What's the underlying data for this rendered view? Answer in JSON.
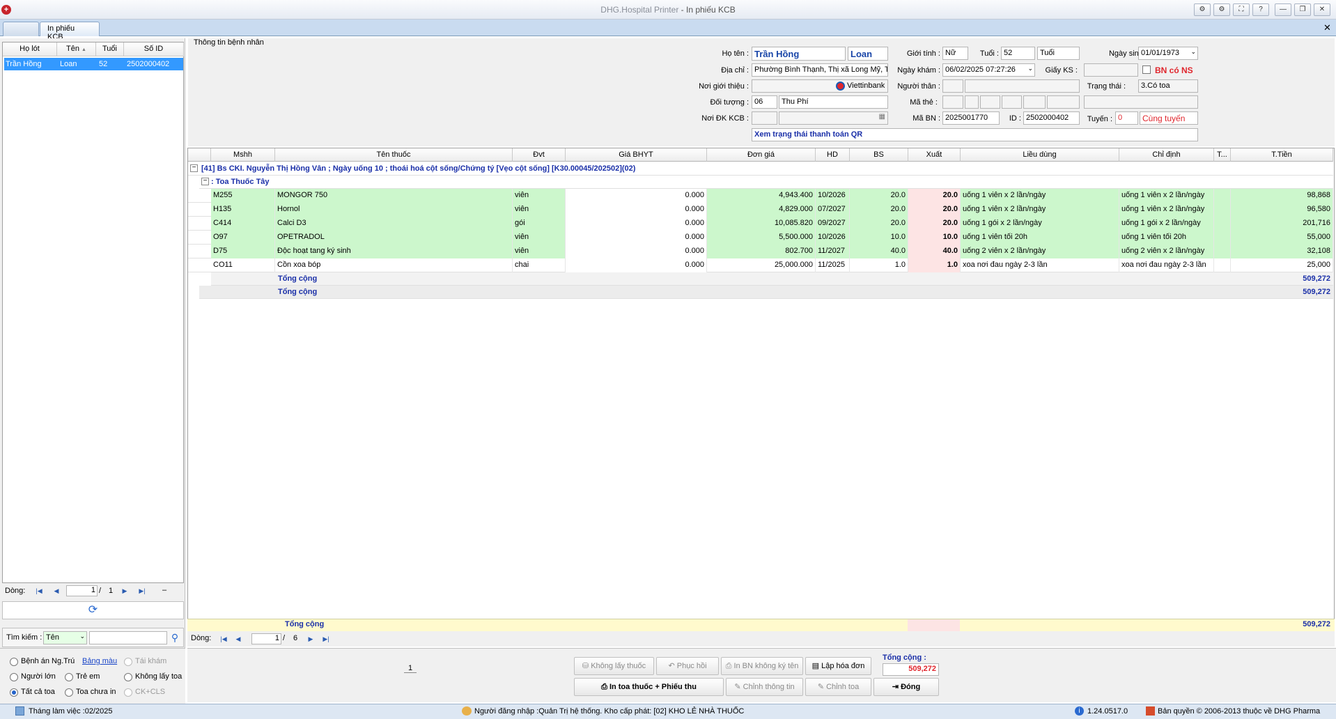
{
  "window": {
    "title_app": "DHG.Hospital Printer",
    "title_sep": " - ",
    "title_form": "In phiếu KCB",
    "controls": [
      "⚙",
      "⚙",
      "⛶",
      "?",
      "—",
      "❐",
      "✕"
    ]
  },
  "tabs": {
    "active": "In phiếu KCB",
    "close": "✕"
  },
  "patient_list": {
    "headers": [
      "Họ lót",
      "Tên",
      "Tuổi",
      "Số ID"
    ],
    "rows": [
      {
        "ho_lot": "Trần Hồng",
        "ten": "Loan",
        "tuoi": "52",
        "so_id": "2502000402"
      }
    ],
    "pager": {
      "label": "Dòng:",
      "page": "1",
      "sep": "/",
      "total": "1",
      "dash": "–"
    }
  },
  "search": {
    "label": "Tìm kiếm :",
    "field": "Tên"
  },
  "filters": {
    "benh_an": "Bệnh án Ng.Trú",
    "bang_mau": "Bảng màu",
    "tai_kham": "Tái khám",
    "nguoi_lon": "Người lớn",
    "tre_em": "Trẻ em",
    "khong_lay_toa": "Không lấy toa",
    "tat_ca_toa": "Tất cả toa",
    "toa_chua_in": "Toa chưa in",
    "ck_cls": "CK+CLS"
  },
  "form": {
    "section_title": "Thông tin bệnh nhân",
    "labels": {
      "ho_ten": "Họ tên :",
      "gioi_tinh": "Giới tính :",
      "tuoi": "Tuổi :",
      "ngay_sinh": "Ngày sinh :",
      "dia_chi": "Địa chỉ :",
      "ngay_kham": "Ngày khám :",
      "giay_ks": "Giấy KS :",
      "bn_co_ns": "BN có NS",
      "noi_gioi_thieu": "Nơi giới thiệu :",
      "nguoi_than": "Người thân :",
      "trang_thai": "Trạng thái :",
      "doi_tuong": "Đối tượng :",
      "ma_the": "Mã thẻ :",
      "noi_dk_kcb": "Nơi ĐK KCB :",
      "ma_bn": "Mã BN :",
      "id": "ID :",
      "tuyen": "Tuyến :"
    },
    "values": {
      "ho_lot": "Trần Hồng",
      "ten": "Loan",
      "gioi_tinh": "Nữ",
      "tuoi": "52",
      "tuoi_unit": "Tuổi",
      "ngay_sinh": "01/01/1973",
      "dia_chi": "Phường Bình Thạnh, Thị xã Long Mỹ, Tỉn",
      "ngay_kham": "06/02/2025 07:27:26",
      "bank": "Viettinbank",
      "trang_thai": "3.Có toa",
      "doi_tuong_code": "06",
      "doi_tuong": "Thu Phí",
      "ma_bn": "2025001770",
      "id": "2502000402",
      "tuyen_code": "0",
      "tuyen": "Cùng tuyến",
      "qr": "Xem trạng thái thanh toán QR"
    }
  },
  "grid": {
    "headers": [
      "Mshh",
      "Tên thuốc",
      "Đvt",
      "Giá BHYT",
      "Đơn giá",
      "HD",
      "BS",
      "Xuất",
      "Liều dùng",
      "Chỉ định",
      "T...",
      "T.Tiền"
    ],
    "group_row": "[41] Bs CKI. Nguyễn Thị Hồng Vân ; Ngày uống 10 ; thoái hoá cột sống/Chứng tý [Vẹo cột sống] [K30.00045/202502](02)",
    "sub_group": ": Toa Thuốc Tây",
    "rows": [
      {
        "mshh": "M255",
        "ten": "MONGOR 750",
        "dvt": "viên",
        "gia_bhyt": "0.000",
        "don_gia": "4,943.400",
        "hd": "10/2026",
        "bs": "20.0",
        "xuat": "20.0",
        "lieu_dung": "uống 1 viên x 2 lần/ngày",
        "chi_dinh": "uống 1 viên x 2 lần/ngày",
        "t": "",
        "tien": "98,868",
        "green": true
      },
      {
        "mshh": "H135",
        "ten": "Hornol",
        "dvt": "viên",
        "gia_bhyt": "0.000",
        "don_gia": "4,829.000",
        "hd": "07/2027",
        "bs": "20.0",
        "xuat": "20.0",
        "lieu_dung": "uống 1 viên x 2 lần/ngày",
        "chi_dinh": "uống 1 viên x 2 lần/ngày",
        "t": "",
        "tien": "96,580",
        "green": true
      },
      {
        "mshh": "C414",
        "ten": "Calci D3",
        "dvt": "gói",
        "gia_bhyt": "0.000",
        "don_gia": "10,085.820",
        "hd": "09/2027",
        "bs": "20.0",
        "xuat": "20.0",
        "lieu_dung": "uống 1 gói x 2 lần/ngày",
        "chi_dinh": "uống 1 gói x 2 lần/ngày",
        "t": "",
        "tien": "201,716",
        "green": true
      },
      {
        "mshh": "O97",
        "ten": "OPETRADOL",
        "dvt": "viên",
        "gia_bhyt": "0.000",
        "don_gia": "5,500.000",
        "hd": "10/2026",
        "bs": "10.0",
        "xuat": "10.0",
        "lieu_dung": "uống 1 viên tối 20h",
        "chi_dinh": "uống 1 viên tối 20h",
        "t": "",
        "tien": "55,000",
        "green": true
      },
      {
        "mshh": "D75",
        "ten": "Độc hoạt tang ký sinh",
        "dvt": "viên",
        "gia_bhyt": "0.000",
        "don_gia": "802.700",
        "hd": "11/2027",
        "bs": "40.0",
        "xuat": "40.0",
        "lieu_dung": "uống 2 viên x 2 lần/ngày",
        "chi_dinh": "uống 2 viên x 2 lần/ngày",
        "t": "",
        "tien": "32,108",
        "green": true
      },
      {
        "mshh": "CO11",
        "ten": "Cồn xoa bóp",
        "dvt": "chai",
        "gia_bhyt": "0.000",
        "don_gia": "25,000.000",
        "hd": "11/2025",
        "bs": "1.0",
        "xuat": "1.0",
        "lieu_dung": "xoa nơi đau ngày 2-3 lần",
        "chi_dinh": "xoa nơi đau ngày 2-3 lần",
        "t": "",
        "tien": "25,000",
        "green": false
      }
    ],
    "subtotal_label": "Tổng cộng",
    "subtotal": "509,272",
    "total_label": "Tổng cộng",
    "total": "509,272",
    "footer_label": "Tổng cộng",
    "footer_total": "509,272",
    "pager": {
      "label": "Dòng:",
      "page": "1",
      "sep": "/",
      "total": "6"
    }
  },
  "actions": {
    "page_number": "1",
    "khong_lay_thuoc": "Không lấy thuốc",
    "phuc_hoi": "Phục hồi",
    "in_bn_khong_ky_ten": "In BN không ký tên",
    "lap_hoa_don": "Lập hóa đơn",
    "in_toa": "In toa thuốc + Phiếu thu",
    "chinh_thong_tin": "Chỉnh thông tin",
    "chinh_toa": "Chỉnh toa",
    "dong": "Đóng",
    "tong_cong_label": "Tổng cộng :",
    "tong_cong": "509,272"
  },
  "status": {
    "thang": "Tháng làm việc :02/2025",
    "user": "Người đăng nhập :Quản Trị hệ thống. Kho cấp phát: [02] KHO LẺ NHÀ THUỐC",
    "version": "1.24.0517.0",
    "copyright": "Bản quyền © 2006-2013 thuộc về DHG Pharma"
  },
  "colors": {
    "accent": "#1a46a8",
    "red": "#e0262d",
    "green_row": "#ccf7cc",
    "pink_cell": "#fde4e4",
    "footer": "#fffacd"
  }
}
